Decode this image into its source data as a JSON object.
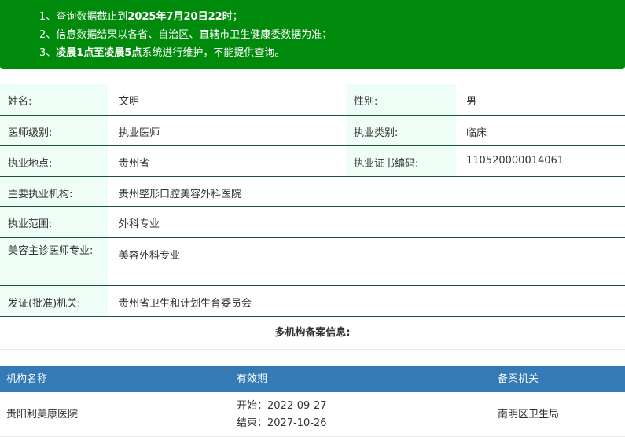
{
  "notice": {
    "line1_prefix": "1、查询数据截止到",
    "line1_bold": "2025年7月20日22时",
    "line1_suffix": "；",
    "line2": "2、信息数据结果以各省、自治区、直辖市卫生健康委数据为准；",
    "line3_prefix": "3、",
    "line3_bold": "凌晨1点至凌晨5点",
    "line3_suffix": "系统进行维护，不能提供查询。"
  },
  "info": {
    "name_label": "姓名:",
    "name_value": "文明",
    "gender_label": "性别:",
    "gender_value": "男",
    "level_label": "医师级别:",
    "level_value": "执业医师",
    "category_label": "执业类别:",
    "category_value": "临床",
    "location_label": "执业地点:",
    "location_value": "贵州省",
    "cert_label": "执业证书编码:",
    "cert_value": "110520000014061",
    "institution_label": "主要执业机构:",
    "institution_value": "贵州整形口腔美容外科医院",
    "scope_label": "执业范围:",
    "scope_value": "外科专业",
    "cosmetic_label": "美容主诊医师专业:",
    "cosmetic_value": "美容外科专业",
    "issuer_label": "发证(批准)机关:",
    "issuer_value": "贵州省卫生和计划生育委员会"
  },
  "multi": {
    "title": "多机构备案信息:",
    "headers": [
      "机构名称",
      "有效期",
      "备案机关"
    ],
    "rows": [
      {
        "name": "贵阳利美康医院",
        "start": "开始：2022-09-27",
        "end": "结束：2027-10-26",
        "authority": "南明区卫生局"
      }
    ]
  }
}
